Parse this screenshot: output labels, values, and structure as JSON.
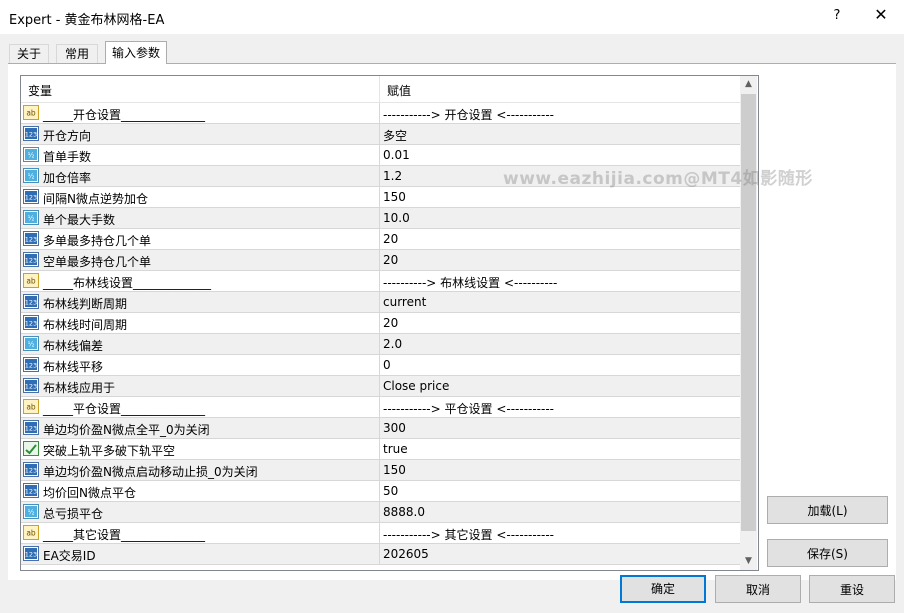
{
  "window": {
    "title": "Expert - 黄金布林网格-EA",
    "help_label": "?",
    "close_label": "✕"
  },
  "tabs": [
    {
      "label": "关于"
    },
    {
      "label": "常用"
    },
    {
      "label": "输入参数",
      "active": true
    }
  ],
  "grid": {
    "columns": {
      "variable": "变量",
      "value": "赋值"
    },
    "rows": [
      {
        "name": "_____开仓设置______________",
        "value": "-----------> 开仓设置 <-----------",
        "icon": "ab"
      },
      {
        "name": "开仓方向",
        "value": "多空",
        "icon": "123"
      },
      {
        "name": "首单手数",
        "value": "0.01",
        "icon": "v2"
      },
      {
        "name": "加仓倍率",
        "value": "1.2",
        "icon": "v2"
      },
      {
        "name": "间隔N微点逆势加仓",
        "value": "150",
        "icon": "123"
      },
      {
        "name": "单个最大手数",
        "value": "10.0",
        "icon": "v2"
      },
      {
        "name": "多单最多持仓几个单",
        "value": "20",
        "icon": "123"
      },
      {
        "name": "空单最多持仓几个单",
        "value": "20",
        "icon": "123"
      },
      {
        "name": "_____布林线设置_____________",
        "value": "----------> 布林线设置 <----------",
        "icon": "ab"
      },
      {
        "name": "布林线判断周期",
        "value": "current",
        "icon": "123"
      },
      {
        "name": "布林线时间周期",
        "value": "20",
        "icon": "123"
      },
      {
        "name": "布林线偏差",
        "value": "2.0",
        "icon": "v2"
      },
      {
        "name": "布林线平移",
        "value": "0",
        "icon": "123"
      },
      {
        "name": "布林线应用于",
        "value": "Close price",
        "icon": "123"
      },
      {
        "name": "_____平仓设置______________",
        "value": "-----------> 平仓设置 <-----------",
        "icon": "ab"
      },
      {
        "name": "单边均价盈N微点全平_0为关闭",
        "value": "300",
        "icon": "123"
      },
      {
        "name": "突破上轨平多破下轨平空",
        "value": "true",
        "icon": "bool"
      },
      {
        "name": "单边均价盈N微点启动移动止损_0为关闭",
        "value": "150",
        "icon": "123"
      },
      {
        "name": "均价回N微点平仓",
        "value": "50",
        "icon": "123"
      },
      {
        "name": "总亏损平仓",
        "value": "8888.0",
        "icon": "v2"
      },
      {
        "name": "_____其它设置______________",
        "value": "-----------> 其它设置 <-----------",
        "icon": "ab"
      },
      {
        "name": "EA交易ID",
        "value": "202605",
        "icon": "123"
      }
    ]
  },
  "watermark": "www.eazhijia.com@MT4如影随形",
  "buttons": {
    "load": "加载(L)",
    "save": "保存(S)",
    "ok": "确定",
    "cancel": "取消",
    "reset": "重设"
  },
  "colors": {
    "accent": "#0078d7",
    "row_alt": "#f0f0f0",
    "icon_int": "#1f5fa8",
    "icon_double": "#1a8cc8",
    "icon_string": "#d9a21b",
    "icon_bool": "#2e8b3a"
  }
}
